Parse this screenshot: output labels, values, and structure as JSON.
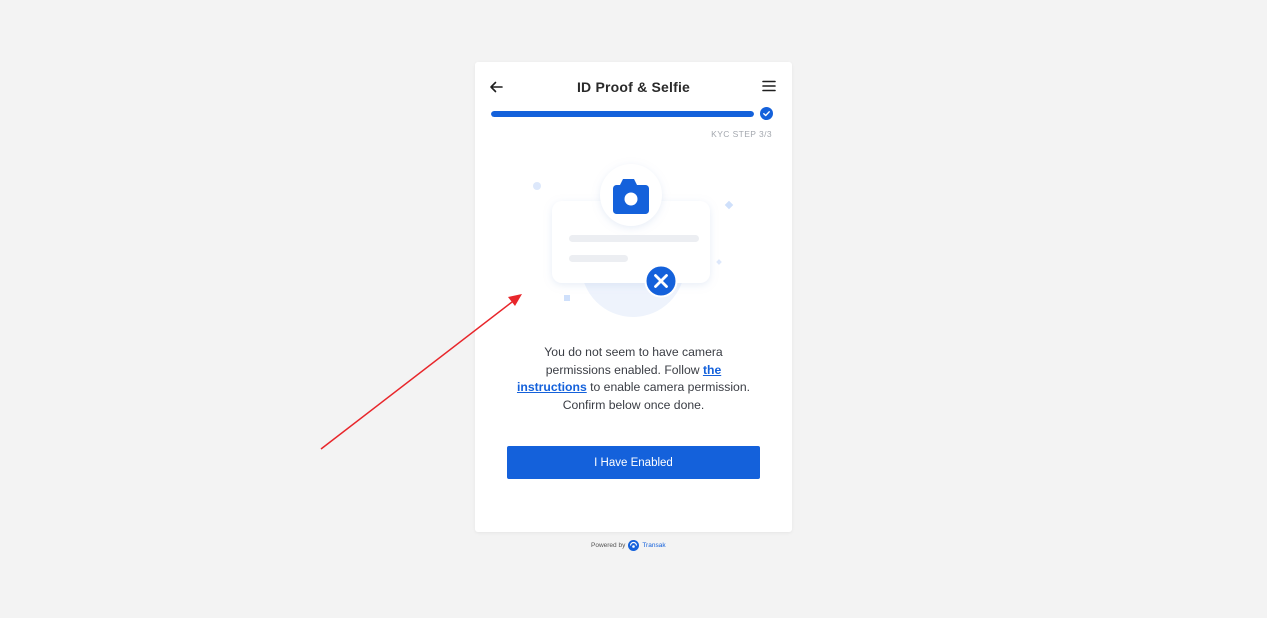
{
  "header": {
    "title": "ID Proof & Selfie",
    "back_icon": "arrow-left-icon",
    "menu_icon": "hamburger-menu-icon"
  },
  "progress": {
    "value": 1.0,
    "step_label": "KYC STEP 3/3",
    "check_icon": "check-circle-icon"
  },
  "illustration": {
    "camera_icon": "camera-icon",
    "error_icon": "x-circle-icon"
  },
  "message": {
    "before_link": "You do not seem to have camera permissions enabled. Follow",
    "link_text": "the instructions",
    "after_link": "to enable camera permission. Confirm below once done."
  },
  "primary_button": {
    "label": "I Have Enabled"
  },
  "footer": {
    "powered_by": "Powered by",
    "brand": "Transak",
    "brand_icon": "transak-logo-icon"
  },
  "colors": {
    "accent": "#1461db",
    "background": "#f3f3f3",
    "card": "#ffffff",
    "annotation_arrow": "#e8262b"
  }
}
